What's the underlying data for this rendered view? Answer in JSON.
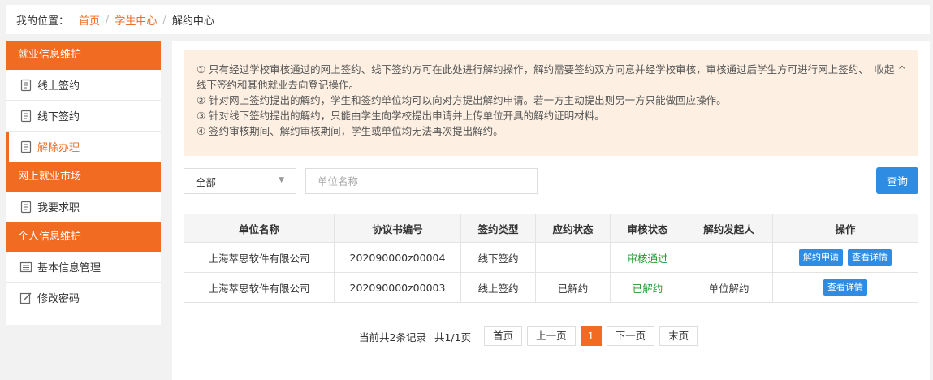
{
  "breadcrumb": {
    "prefix": "我的位置：",
    "items": [
      "首页",
      "学生中心",
      "解约中心"
    ],
    "separator": "/"
  },
  "sidebar": {
    "sections": [
      {
        "title": "就业信息维护",
        "items": [
          "线上签约",
          "线下签约",
          "解除办理"
        ]
      },
      {
        "title": "网上就业市场",
        "items": [
          "我要求职"
        ]
      },
      {
        "title": "个人信息维护",
        "items": [
          "基本信息管理",
          "修改密码"
        ]
      }
    ],
    "active_item": "解除办理"
  },
  "notice": {
    "collapse_label": "收起 ^",
    "lines": [
      "① 只有经过学校审核通过的网上签约、线下签约方可在此处进行解约操作，解约需要签约双方同意并经学校审核，审核通过后学生方可进行网上签约、线下签约和其他就业去向登记操作。",
      "② 针对网上签约提出的解约，学生和签约单位均可以向对方提出解约申请。若一方主动提出则另一方只能做回应操作。",
      "③ 针对线下签约提出的解约，只能由学生向学校提出申请并上传单位开具的解约证明材料。",
      "④ 签约审核期间、解约审核期间，学生或单位均无法再次提出解约。"
    ]
  },
  "filter": {
    "select_value": "全部",
    "search_placeholder": "单位名称",
    "query_label": "查询"
  },
  "table": {
    "headers": [
      "单位名称",
      "协议书编号",
      "签约类型",
      "应约状态",
      "审核状态",
      "解约发起人",
      "操作"
    ],
    "rows": [
      {
        "company": "上海萃思软件有限公司",
        "agreement_no": "202090000z00004",
        "sign_type": "线下签约",
        "appointment_status": "",
        "review_status": "审核通过",
        "initiator": "",
        "actions": [
          "解约申请",
          "查看详情"
        ]
      },
      {
        "company": "上海萃思软件有限公司",
        "agreement_no": "202090000z00003",
        "sign_type": "线上签约",
        "appointment_status": "已解约",
        "review_status": "已解约",
        "initiator": "单位解约",
        "actions": [
          "查看详情"
        ]
      }
    ]
  },
  "pager": {
    "total_info": "当前共2条记录",
    "page_info": "共1/1页",
    "first": "首页",
    "prev": "上一页",
    "current": "1",
    "next": "下一页",
    "last": "末页"
  },
  "colors": {
    "accent": "#f26b22",
    "primary_button": "#2e8de2",
    "success_text": "#1f9b2e",
    "notice_bg": "#fdf0e2"
  }
}
